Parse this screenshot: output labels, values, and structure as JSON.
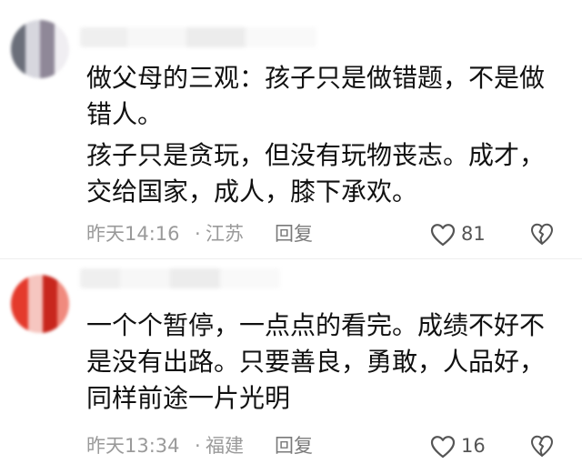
{
  "comments": [
    {
      "paragraphs": [
        "做父母的三观：孩子只是做错题，不是做错人。",
        "孩子只是贪玩，但没有玩物丧志。成才，交给国家，成人，膝下承欢。"
      ],
      "time": "昨天14:16",
      "separator": "·",
      "location": "江苏",
      "reply_label": "回复",
      "likes": "81",
      "icons": {
        "like": "heart-outline-icon",
        "dislike": "broken-heart-icon"
      }
    },
    {
      "paragraphs": [
        "一个个暂停，一点点的看完。成绩不好不是没有出路。只要善良，勇敢，人品好，同样前途一片光明"
      ],
      "time": "昨天13:34",
      "separator": "·",
      "location": "福建",
      "reply_label": "回复",
      "likes": "16",
      "icons": {
        "like": "heart-outline-icon",
        "dislike": "broken-heart-icon"
      }
    }
  ],
  "colors": {
    "text": "#111111",
    "meta": "#9a9a9a",
    "icon": "#555555"
  }
}
